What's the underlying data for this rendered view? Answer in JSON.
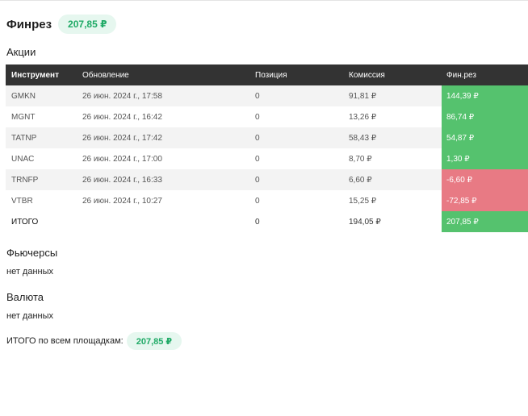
{
  "header": {
    "title": "Финрез",
    "total": "207,85 ₽"
  },
  "stocks": {
    "title": "Акции",
    "columns": [
      "Инструмент",
      "Обновление",
      "Позиция",
      "Комиссия",
      "Фин.рез"
    ],
    "rows": [
      {
        "instrument": "GMKN",
        "updated": "26 июн. 2024 г., 17:58",
        "position": "0",
        "commission": "91,81 ₽",
        "pnl": "144,39 ₽",
        "pnl_sign": "pos"
      },
      {
        "instrument": "MGNT",
        "updated": "26 июн. 2024 г., 16:42",
        "position": "0",
        "commission": "13,26 ₽",
        "pnl": "86,74 ₽",
        "pnl_sign": "pos"
      },
      {
        "instrument": "TATNP",
        "updated": "26 июн. 2024 г., 17:42",
        "position": "0",
        "commission": "58,43 ₽",
        "pnl": "54,87 ₽",
        "pnl_sign": "pos"
      },
      {
        "instrument": "UNAC",
        "updated": "26 июн. 2024 г., 17:00",
        "position": "0",
        "commission": "8,70 ₽",
        "pnl": "1,30 ₽",
        "pnl_sign": "pos"
      },
      {
        "instrument": "TRNFP",
        "updated": "26 июн. 2024 г., 16:33",
        "position": "0",
        "commission": "6,60 ₽",
        "pnl": "-6,60 ₽",
        "pnl_sign": "neg"
      },
      {
        "instrument": "VTBR",
        "updated": "26 июн. 2024 г., 10:27",
        "position": "0",
        "commission": "15,25 ₽",
        "pnl": "-72,85 ₽",
        "pnl_sign": "neg"
      }
    ],
    "total": {
      "label": "ИТОГО",
      "position": "0",
      "commission": "194,05 ₽",
      "pnl": "207,85 ₽"
    }
  },
  "futures": {
    "title": "Фьючерсы",
    "empty": "нет данных"
  },
  "currency": {
    "title": "Валюта",
    "empty": "нет данных"
  },
  "footer": {
    "label": "ИТОГО по всем площадкам:",
    "total": "207,85 ₽"
  },
  "colors": {
    "positive": "#55c26e",
    "negative": "#e87a84",
    "header_bg": "#333333",
    "pill_bg": "#e6f7ef",
    "pill_text": "#1faa66"
  }
}
